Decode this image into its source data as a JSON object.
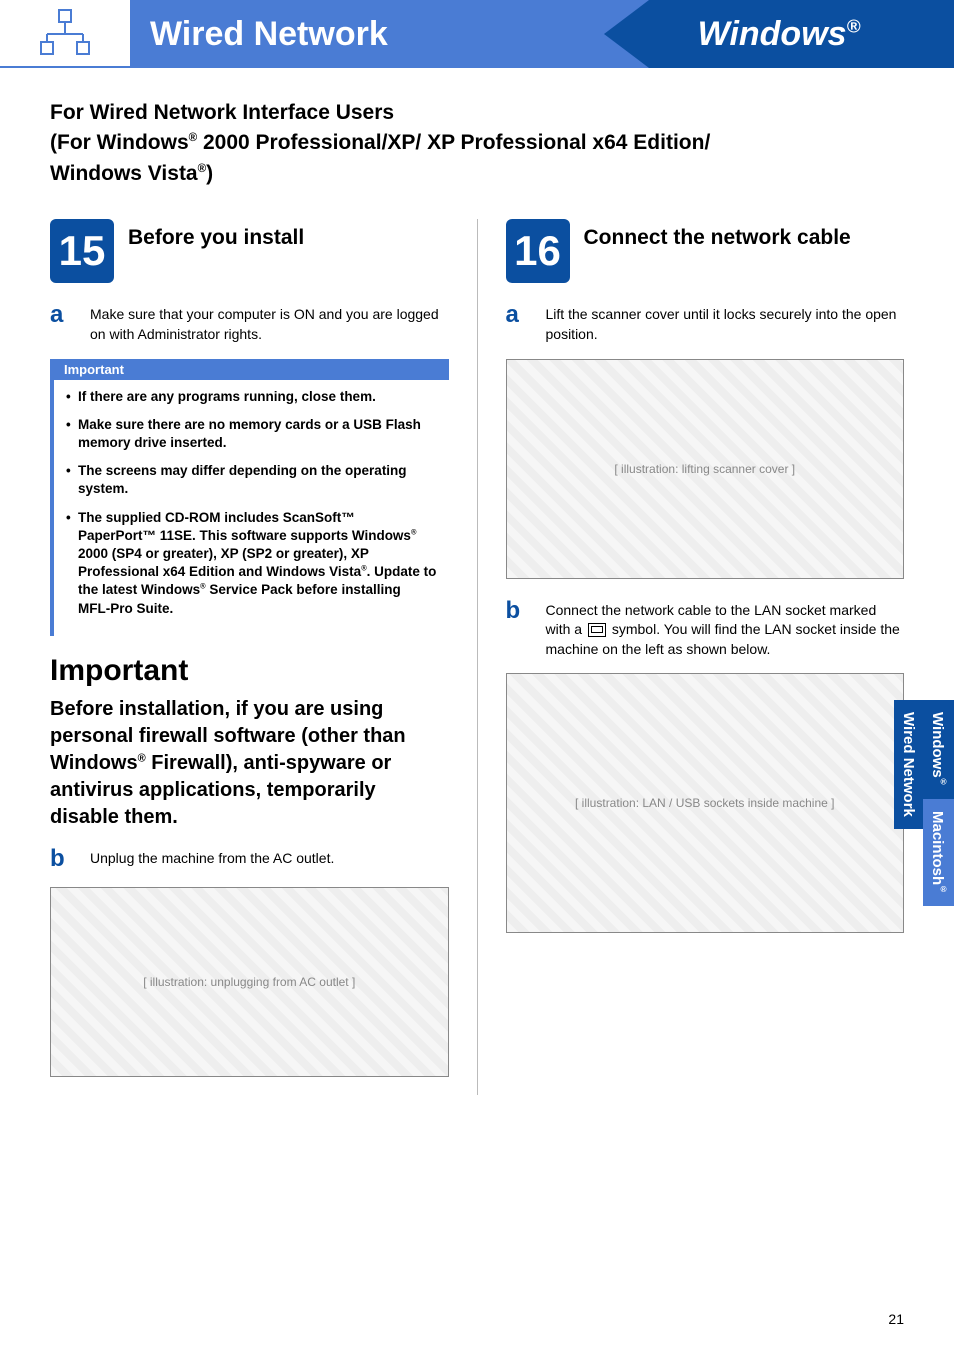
{
  "header": {
    "banner_left": "Wired Network",
    "banner_right": "Windows",
    "reg": "®"
  },
  "main_heading_l1": "For Wired Network Interface Users",
  "main_heading_l2a": "(For Windows",
  "main_heading_l2b": " 2000 Professional/XP/ XP Professional x64 Edition/",
  "main_heading_l3a": "Windows Vista",
  "main_heading_l3b": ")",
  "step15": {
    "num": "15",
    "title": "Before you install",
    "a_text": "Make sure that your computer is ON and you are logged on with Administrator rights.",
    "important_label": "Important",
    "important_items": {
      "i0": "If there are any programs running, close them.",
      "i1": "Make sure there are no memory cards or a USB Flash memory drive inserted.",
      "i2": "The screens may differ depending on the operating system.",
      "i3a": "The supplied CD-ROM includes ScanSoft™ PaperPort™ 11SE. This software supports Windows",
      "i3b": " 2000 (SP4 or greater), XP (SP2 or greater), XP Professional x64 Edition and Windows Vista",
      "i3c": ". Update to the latest Windows",
      "i3d": " Service Pack before installing MFL-Pro Suite."
    },
    "big_important_heading": "Important",
    "big_important_text_a": "Before installation, if you are using personal firewall software (other than Windows",
    "big_important_text_b": " Firewall), anti-spyware or antivirus applications, temporarily disable them.",
    "b_text": "Unplug the machine from the AC outlet."
  },
  "step16": {
    "num": "16",
    "title": "Connect the network cable",
    "a_text": "Lift the scanner cover until it locks securely into the open position.",
    "b_text_a": "Connect the network cable to the LAN socket marked with a ",
    "b_text_b": " symbol. You will find the LAN socket inside the machine on the left as shown below."
  },
  "side_tabs": {
    "windows": "Windows",
    "mac": "Macintosh",
    "wired": "Wired Network",
    "reg": "®"
  },
  "page_number": "21",
  "diagrams": {
    "d1": "[ illustration: lifting scanner cover ]",
    "d2": "[ illustration: unplugging from AC outlet ]",
    "d3": "[ illustration: LAN / USB sockets inside machine ]"
  }
}
